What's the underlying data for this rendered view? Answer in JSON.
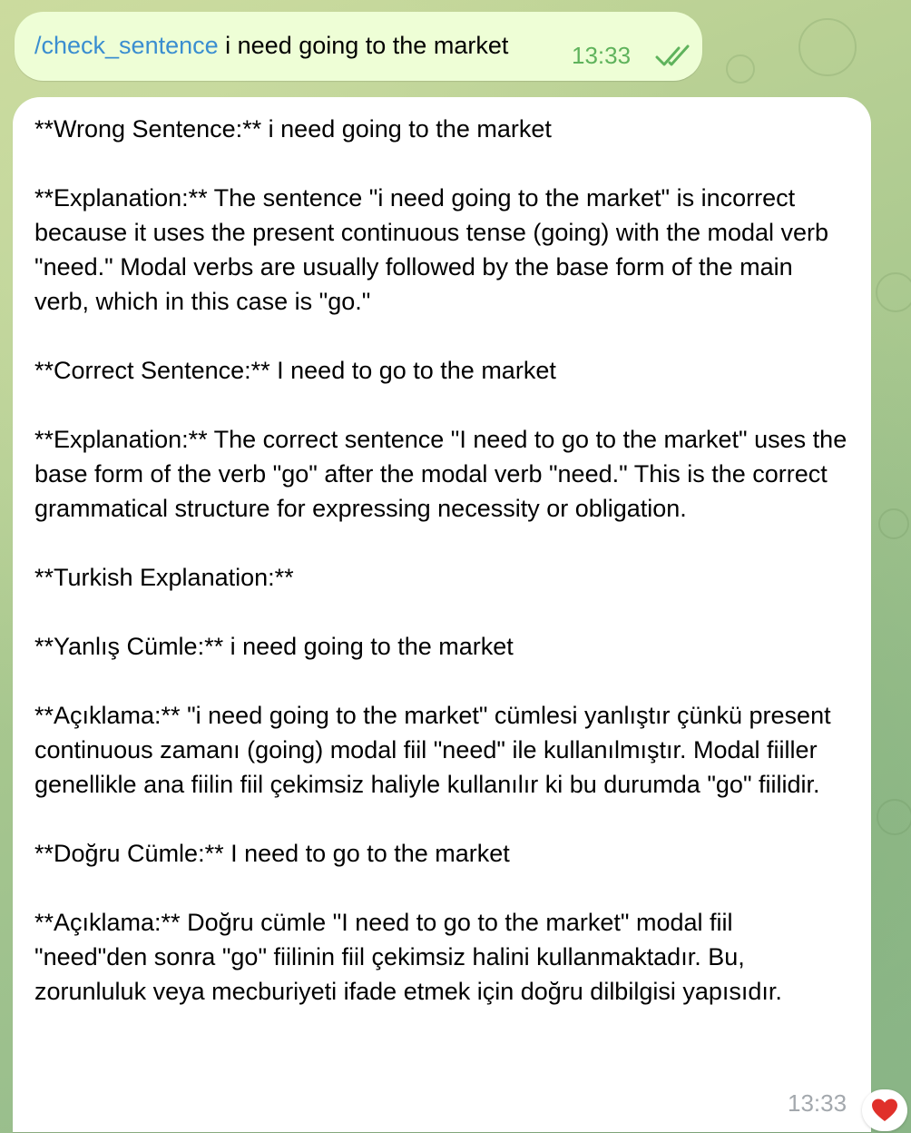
{
  "outgoing": {
    "command": "/check_sentence",
    "text": " i need going to the market",
    "time": "13:33"
  },
  "incoming": {
    "paragraphs": [
      "**Wrong Sentence:** i need going to the market",
      "**Explanation:** The sentence \"i need going to the market\" is incorrect because it uses the present continuous tense (going) with the modal verb \"need.\" Modal verbs are usually followed by the base form of the main verb, which in this case is \"go.\"",
      "**Correct Sentence:** I need to go to the market",
      "**Explanation:** The correct sentence \"I need to go to the market\" uses the base form of the verb \"go\" after the modal verb \"need.\" This is the correct grammatical structure for expressing necessity or obligation.",
      "**Turkish Explanation:**",
      "**Yanlış Cümle:** i need going to the market",
      "**Açıklama:** \"i need going to the market\" cümlesi yanlıştır çünkü present continuous zamanı (going) modal fiil \"need\" ile kullanılmıştır. Modal fiiller genellikle ana fiilin fiil çekimsiz haliyle kullanılır ki bu durumda \"go\" fiilidir.",
      "**Doğru Cümle:** I need to go to the market",
      "**Açıklama:** Doğru cümle \"I need to go to the market\" modal fiil \"need\"den sonra \"go\" fiilinin fiil çekimsiz halini kullanmaktadır. Bu, zorunluluk veya mecburiyeti ifade etmek için doğru dilbilgisi yapısıdır."
    ],
    "time": "13:33",
    "reaction": "heart-icon"
  },
  "colors": {
    "outgoing_bubble": "#eefed6",
    "incoming_bubble": "#ffffff",
    "command_link": "#3a8ed0",
    "outgoing_time": "#5fb35c",
    "incoming_time": "#a3a8ad",
    "reaction_heart": "#e0302a"
  }
}
